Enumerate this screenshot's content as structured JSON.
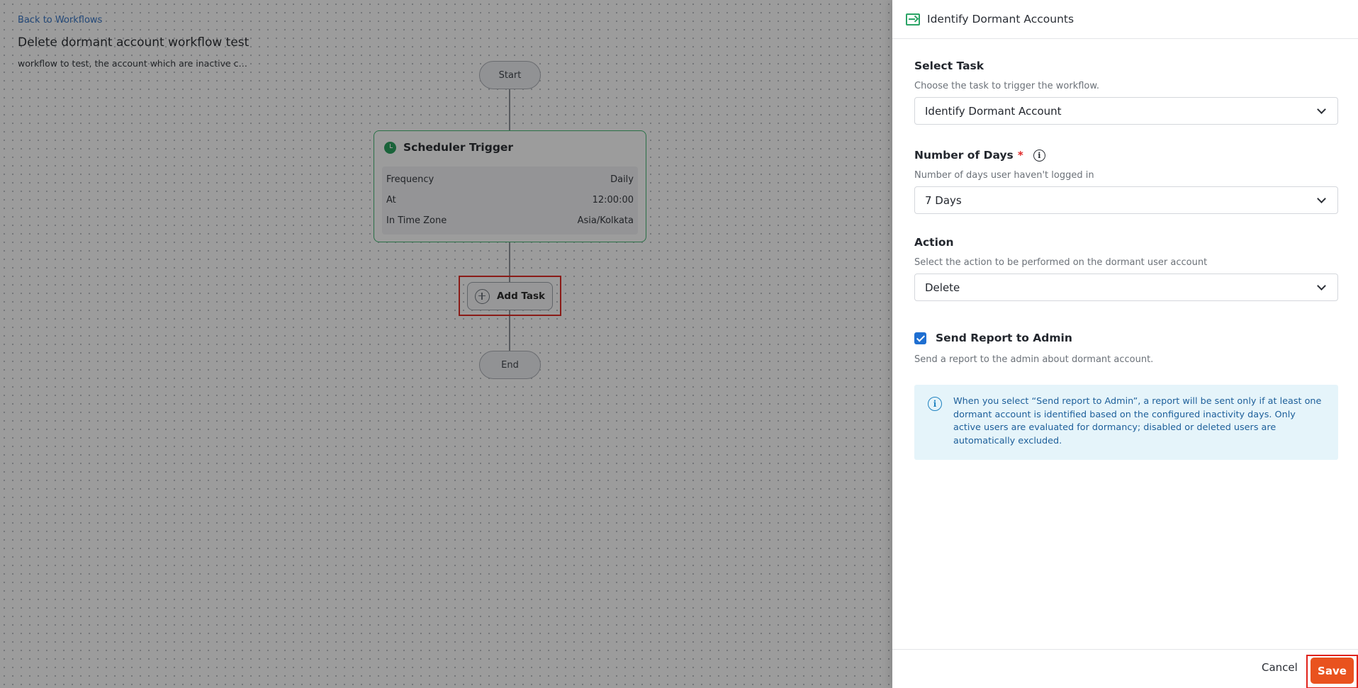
{
  "workflow": {
    "back_link": "Back to Workflows",
    "title": "Delete dormant account workflow test",
    "description": "workflow to test, the account which are inactive can be deleted"
  },
  "flow": {
    "start_label": "Start",
    "end_label": "End",
    "add_task_label": "Add Task",
    "trigger": {
      "title": "Scheduler Trigger",
      "rows": [
        {
          "label": "Frequency",
          "value": "Daily"
        },
        {
          "label": "At",
          "value": "12:00:00"
        },
        {
          "label": "In Time Zone",
          "value": "Asia/Kolkata"
        }
      ]
    }
  },
  "drawer": {
    "title": "Identify Dormant Accounts",
    "select_task": {
      "label": "Select Task",
      "hint": "Choose the task to trigger the workflow.",
      "value": "Identify Dormant Account"
    },
    "days": {
      "label": "Number of Days",
      "required_mark": "*",
      "hint": "Number of days user haven't logged in",
      "value": "7 Days"
    },
    "action": {
      "label": "Action",
      "hint": "Select the action to be performed on the dormant user account",
      "value": "Delete"
    },
    "report": {
      "label": "Send Report to Admin",
      "checked": true,
      "hint": "Send a report to the admin about dormant account."
    },
    "info_text": "When you select “Send report to Admin”, a report will be sent only if at least one dormant account is identified based on the configured inactivity days. Only active users are evaluated for dormancy; disabled or deleted users are automatically excluded.",
    "cancel_label": "Cancel",
    "save_label": "Save"
  },
  "colors": {
    "accent_green": "#2aa466",
    "save_orange": "#e9521e",
    "highlight_red": "#e0221b",
    "checkbox_blue": "#1f6fd1",
    "info_bg": "#e5f4fa"
  },
  "icons": {
    "trigger": "clock-icon",
    "add_task": "plus-circle-icon",
    "drawer_header": "entry-arrow-icon",
    "days_info": "info-icon",
    "info_box": "info-icon",
    "select": "chevron-down-icon"
  }
}
